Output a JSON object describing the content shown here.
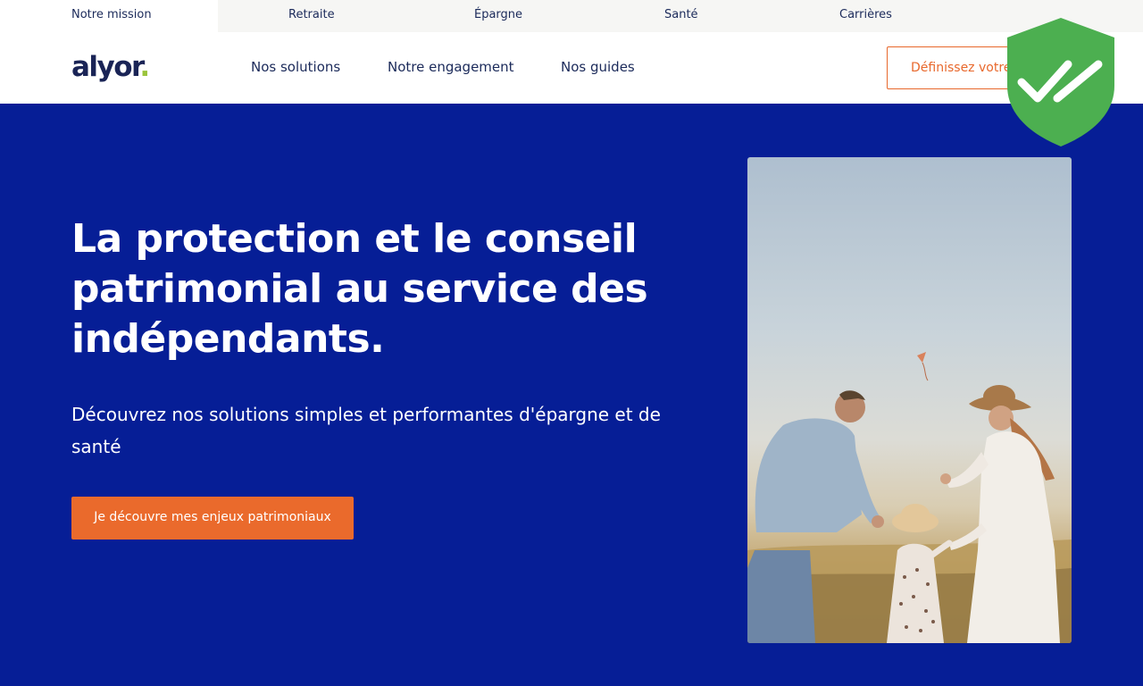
{
  "topbar": {
    "tabs": [
      {
        "label": "Notre mission"
      },
      {
        "label": "Retraite"
      },
      {
        "label": "Épargne"
      },
      {
        "label": "Santé"
      },
      {
        "label": "Carrières"
      }
    ]
  },
  "header": {
    "logo_text": "alyor",
    "logo_dot": ".",
    "nav": [
      {
        "label": "Nos solutions"
      },
      {
        "label": "Notre engagement"
      },
      {
        "label": "Nos guides"
      }
    ],
    "cta_label": "Définissez votre"
  },
  "hero": {
    "title": "La protection et le conseil patrimonial au service des indépendants.",
    "subtitle": "Découvrez nos solutions simples et performantes d'épargne et de santé",
    "button_label": "Je découvre mes enjeux patrimoniaux"
  },
  "colors": {
    "hero_background": "#061e96",
    "accent_orange": "#ea6a2c",
    "logo_dot_green": "#9bc43c",
    "shield_green": "#4caf50"
  },
  "icons": {
    "badge": "shield-double-check-icon"
  }
}
